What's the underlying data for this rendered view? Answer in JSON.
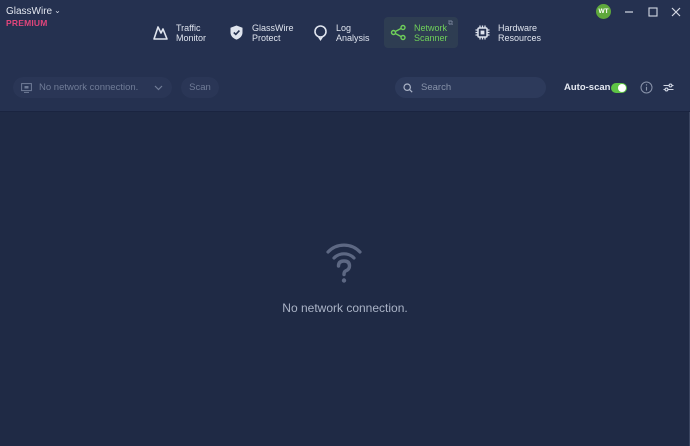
{
  "app": {
    "name": "GlassWire",
    "tier": "PREMIUM",
    "avatar_initials": "WT"
  },
  "nav": {
    "tabs": [
      {
        "id": "traffic",
        "label": "Traffic\nMonitor",
        "icon": "traffic-monitor-icon",
        "active": false
      },
      {
        "id": "protect",
        "label": "GlassWire\nProtect",
        "icon": "shield-icon",
        "active": false
      },
      {
        "id": "log",
        "label": "Log\nAnalysis",
        "icon": "log-pin-icon",
        "active": false
      },
      {
        "id": "scanner",
        "label": "Network\nScanner",
        "icon": "network-scanner-icon",
        "active": true
      },
      {
        "id": "hardware",
        "label": "Hardware\nResources",
        "icon": "chip-icon",
        "active": false
      }
    ]
  },
  "toolbar": {
    "connection_value": "No network connection.",
    "scan_label": "Scan",
    "search_placeholder": "Search",
    "autoscan_label": "Auto-scan",
    "autoscan_on": true
  },
  "empty_state": {
    "message": "No network connection."
  },
  "colors": {
    "accent_green": "#6fd05a",
    "premium_pink": "#e0457b",
    "background": "#1f2a45",
    "header": "#253150"
  }
}
